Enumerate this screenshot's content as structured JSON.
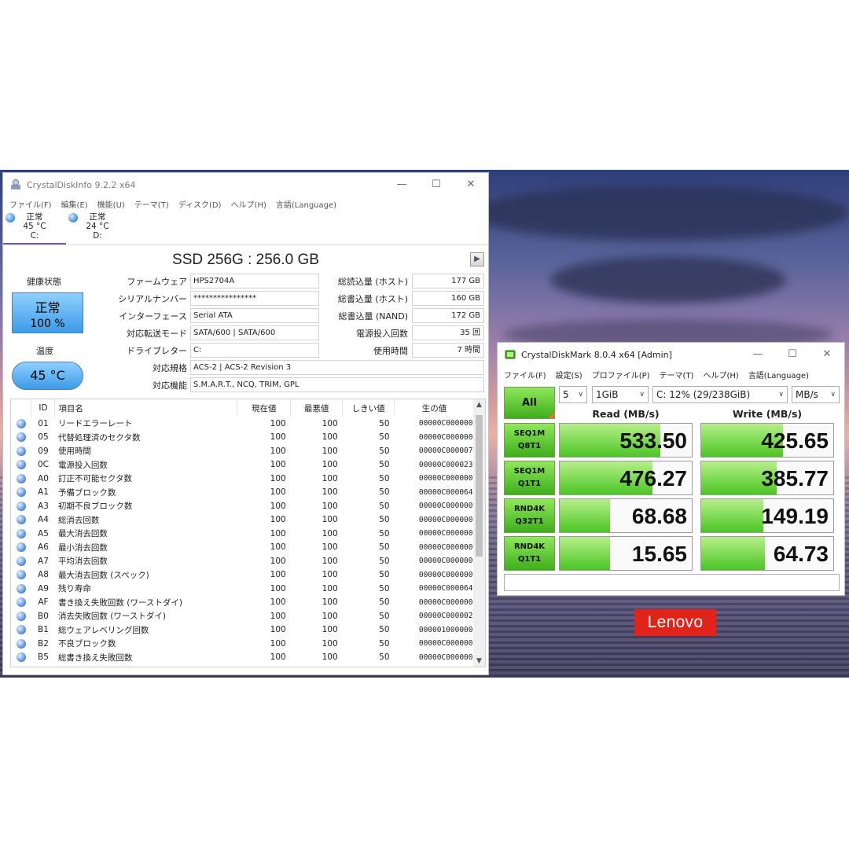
{
  "crystaldiskinfo": {
    "title": "CrystalDiskInfo 9.2.2 x64",
    "window_buttons": [
      "—",
      "☐",
      "✕"
    ],
    "menu": [
      "ファイル(F)",
      "編集(E)",
      "機能(U)",
      "テーマ(T)",
      "ディスク(D)",
      "ヘルプ(H)",
      "言語(Language)"
    ],
    "drives": [
      {
        "status": "正常",
        "temp": "45 °C",
        "letter": "C:"
      },
      {
        "status": "正常",
        "temp": "24 °C",
        "letter": "D:"
      }
    ],
    "model": "SSD 256G : 256.0 GB",
    "health_label": "健康状態",
    "health_status": "正常",
    "health_percent": "100 %",
    "temp_label": "温度",
    "temp_value": "45 °C",
    "info": {
      "firmware_label": "ファームウェア",
      "firmware": "HPS2704A",
      "serial_label": "シリアルナンバー",
      "serial": "****************",
      "interface_label": "インターフェース",
      "interface": "Serial ATA",
      "transfer_label": "対応転送モード",
      "transfer": "SATA/600 | SATA/600",
      "drive_letter_label": "ドライブレター",
      "drive_letter": "C:",
      "standard_label": "対応規格",
      "standard": "ACS-2 | ACS-2 Revision 3",
      "features_label": "対応機能",
      "features": "S.M.A.R.T., NCQ, TRIM, GPL",
      "host_reads_label": "総読込量 (ホスト)",
      "host_reads": "177 GB",
      "host_writes_label": "総書込量 (ホスト)",
      "host_writes": "160 GB",
      "nand_writes_label": "総書込量 (NAND)",
      "nand_writes": "172 GB",
      "power_on_count_label": "電源投入回数",
      "power_on_count": "35 回",
      "power_on_hours_label": "使用時間",
      "power_on_hours": "7 時間"
    },
    "smart_headers": [
      "",
      "ID",
      "項目名",
      "現在値",
      "最悪値",
      "しきい値",
      "生の値"
    ],
    "smart_rows": [
      {
        "id": "01",
        "name": "リードエラーレート",
        "cur": "100",
        "worst": "100",
        "thr": "50",
        "raw": "00000C000000"
      },
      {
        "id": "05",
        "name": "代替処理済のセクタ数",
        "cur": "100",
        "worst": "100",
        "thr": "50",
        "raw": "00000C000000"
      },
      {
        "id": "09",
        "name": "使用時間",
        "cur": "100",
        "worst": "100",
        "thr": "50",
        "raw": "00000C000007"
      },
      {
        "id": "0C",
        "name": "電源投入回数",
        "cur": "100",
        "worst": "100",
        "thr": "50",
        "raw": "00000C000023"
      },
      {
        "id": "A0",
        "name": "訂正不可能セクタ数",
        "cur": "100",
        "worst": "100",
        "thr": "50",
        "raw": "00000C000000"
      },
      {
        "id": "A1",
        "name": "予備ブロック数",
        "cur": "100",
        "worst": "100",
        "thr": "50",
        "raw": "00000C000064"
      },
      {
        "id": "A3",
        "name": "初期不良ブロック数",
        "cur": "100",
        "worst": "100",
        "thr": "50",
        "raw": "00000C000000"
      },
      {
        "id": "A4",
        "name": "総消去回数",
        "cur": "100",
        "worst": "100",
        "thr": "50",
        "raw": "00000C000000"
      },
      {
        "id": "A5",
        "name": "最大消去回数",
        "cur": "100",
        "worst": "100",
        "thr": "50",
        "raw": "00000C000000"
      },
      {
        "id": "A6",
        "name": "最小消去回数",
        "cur": "100",
        "worst": "100",
        "thr": "50",
        "raw": "00000C000000"
      },
      {
        "id": "A7",
        "name": "平均消去回数",
        "cur": "100",
        "worst": "100",
        "thr": "50",
        "raw": "00000C000000"
      },
      {
        "id": "A8",
        "name": "最大消去回数 (スペック)",
        "cur": "100",
        "worst": "100",
        "thr": "50",
        "raw": "00000C000000"
      },
      {
        "id": "A9",
        "name": "残り寿命",
        "cur": "100",
        "worst": "100",
        "thr": "50",
        "raw": "00000C000064"
      },
      {
        "id": "AF",
        "name": "書き換え失敗回数 (ワーストダイ)",
        "cur": "100",
        "worst": "100",
        "thr": "50",
        "raw": "00000C000000"
      },
      {
        "id": "B0",
        "name": "消去失敗回数 (ワーストダイ)",
        "cur": "100",
        "worst": "100",
        "thr": "50",
        "raw": "00000C000002"
      },
      {
        "id": "B1",
        "name": "総ウェアレベリング回数",
        "cur": "100",
        "worst": "100",
        "thr": "50",
        "raw": "000001000000"
      },
      {
        "id": "B2",
        "name": "不良ブロック数",
        "cur": "100",
        "worst": "100",
        "thr": "50",
        "raw": "00000C000000"
      },
      {
        "id": "B5",
        "name": "総書き換え失敗回数",
        "cur": "100",
        "worst": "100",
        "thr": "50",
        "raw": "00000C000000"
      }
    ]
  },
  "crystaldiskmark": {
    "title": "CrystalDiskMark 8.0.4 x64 [Admin]",
    "window_buttons": [
      "—",
      "☐",
      "✕"
    ],
    "menu": [
      "ファイル(F)",
      "設定(S)",
      "プロファイル(P)",
      "テーマ(T)",
      "ヘルプ(H)",
      "言語(Language)"
    ],
    "all_button": "All",
    "count": "5",
    "size": "1GiB",
    "drive": "C: 12% (29/238GiB)",
    "unit": "MB/s",
    "read_header": "Read (MB/s)",
    "write_header": "Write (MB/s)",
    "tests": [
      {
        "line1": "SEQ1M",
        "line2": "Q8T1",
        "read": "533.50",
        "write": "425.65",
        "read_fill": 0.76,
        "write_fill": 0.62
      },
      {
        "line1": "SEQ1M",
        "line2": "Q1T1",
        "read": "476.27",
        "write": "385.77",
        "read_fill": 0.7,
        "write_fill": 0.57
      },
      {
        "line1": "RND4K",
        "line2": "Q32T1",
        "read": "68.68",
        "write": "149.19",
        "read_fill": 0.38,
        "write_fill": 0.47
      },
      {
        "line1": "RND4K",
        "line2": "Q1T1",
        "read": "15.65",
        "write": "64.73",
        "read_fill": 0.38,
        "write_fill": 0.48
      }
    ]
  },
  "brand": "Lenovo",
  "colors": {
    "accent_green": "#4cc524",
    "health_blue": "#3c9be6",
    "lenovo_red": "#e2231a"
  }
}
